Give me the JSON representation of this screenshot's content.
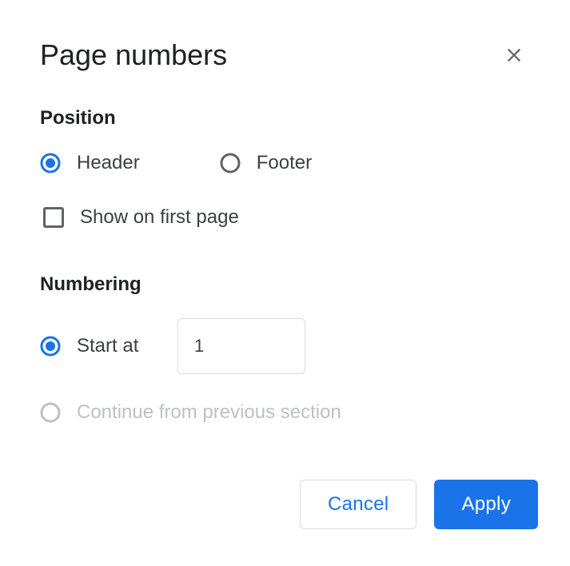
{
  "dialog": {
    "title": "Page numbers"
  },
  "position": {
    "heading": "Position",
    "options": {
      "header": {
        "label": "Header",
        "selected": true
      },
      "footer": {
        "label": "Footer",
        "selected": false
      }
    },
    "show_first_page": {
      "label": "Show on first page",
      "checked": false
    }
  },
  "numbering": {
    "heading": "Numbering",
    "start_at": {
      "label": "Start at",
      "value": "1",
      "selected": true
    },
    "continue": {
      "label": "Continue from previous section",
      "selected": false,
      "disabled": true
    }
  },
  "buttons": {
    "cancel": "Cancel",
    "apply": "Apply"
  },
  "colors": {
    "accent": "#1a73e8",
    "radio_unselected": "#5f6368",
    "disabled": "#bdc1c6"
  }
}
